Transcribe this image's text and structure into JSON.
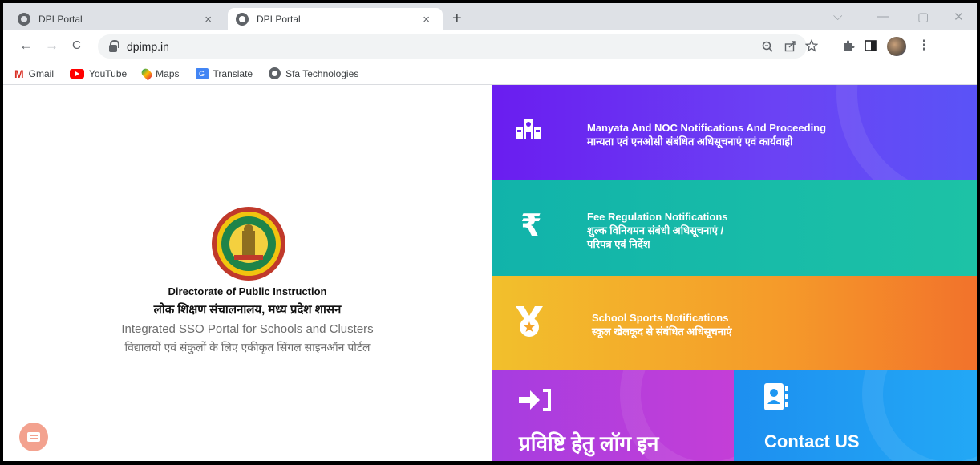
{
  "browser": {
    "tabs": [
      {
        "title": "DPI Portal",
        "close": "×"
      },
      {
        "title": "DPI Portal",
        "close": "×"
      }
    ],
    "new_tab": "+",
    "window_controls": {
      "minimize": "—",
      "restore": "▢",
      "close": "✕",
      "dropdown": "⌵"
    },
    "nav": {
      "back": "←",
      "forward": "→",
      "reload": "C"
    },
    "url": "dpimp.in",
    "toolbar_icons": [
      "zoom-icon",
      "share-icon",
      "star-icon",
      "extensions-icon",
      "sidepanel-icon",
      "profile-avatar",
      "menu-icon"
    ],
    "menu": "⋮",
    "bookmarks": [
      {
        "label": "Gmail",
        "icon": "gmail-icon"
      },
      {
        "label": "YouTube",
        "icon": "youtube-icon"
      },
      {
        "label": "Maps",
        "icon": "maps-icon"
      },
      {
        "label": "Translate",
        "icon": "translate-icon"
      },
      {
        "label": "Sfa Technologies",
        "icon": "globe-icon"
      }
    ]
  },
  "left": {
    "emblem": "mp-state-emblem",
    "line1": "Directorate of Public Instruction",
    "line2": "लोक शिक्षण संचालनालय, मध्य प्रदेश शासन",
    "line3": "Integrated SSO Portal for Schools and Clusters",
    "line4": "विद्यालयों एवं संकुलों के लिए एकीकृत सिंगल साइनऑन पोर्टल"
  },
  "panels": {
    "manyata": {
      "icon": "school-building-icon",
      "title": "Manyata And NOC Notifications And Proceeding",
      "subtitle": "मान्यता एवं एनओसी संबंधित अधिसूचनाएं एवं कार्यवाही",
      "color_start": "#6a1df0",
      "color_end": "#5a53f7"
    },
    "fee": {
      "icon": "rupee-icon",
      "title": "Fee Regulation Notifications",
      "subtitle_line1": "शुल्क विनियमन संबंधी अधिसूचनाएं /",
      "subtitle_line2": "परिपत्र एवं निर्देश",
      "symbol": "₹",
      "color_start": "#11b3aa",
      "color_end": "#1dc2a6"
    },
    "sports": {
      "icon": "medal-icon",
      "title": "School Sports Notifications",
      "subtitle": "स्कूल खेलकूद से संबंधित अधिसूचनाएं",
      "color_start": "#f2c02c",
      "color_end": "#f2722b"
    },
    "login": {
      "icon": "login-icon",
      "label": "प्रविष्टि हेतु लॉग इन",
      "color": "#b33edb"
    },
    "contact": {
      "icon": "contact-book-icon",
      "label": "Contact US",
      "color": "#1d97f2"
    }
  },
  "chat": {
    "icon": "chat-icon",
    "color": "#f3a28f"
  }
}
